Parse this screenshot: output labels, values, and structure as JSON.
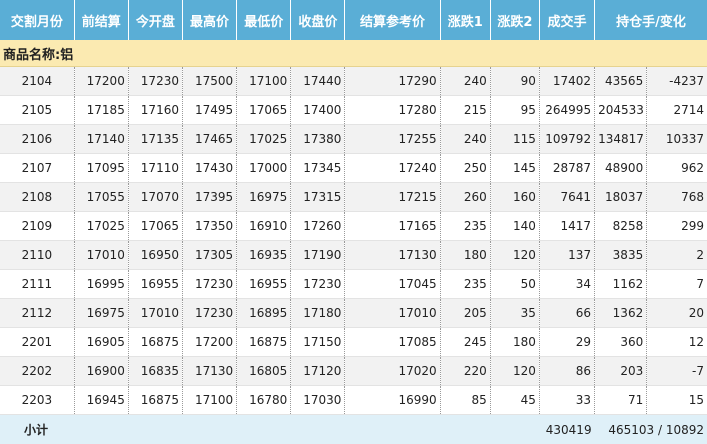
{
  "table": {
    "headers": [
      "交割月份",
      "前结算",
      "今开盘",
      "最高价",
      "最低价",
      "收盘价",
      "结算参考价",
      "涨跌1",
      "涨跌2",
      "成交手",
      "持仓手/变化"
    ],
    "group_label": "商品名称:铝",
    "rows": [
      [
        "2104",
        "17200",
        "17230",
        "17500",
        "17100",
        "17440",
        "17290",
        "240",
        "90",
        "17402",
        "43565",
        "-4237"
      ],
      [
        "2105",
        "17185",
        "17160",
        "17495",
        "17065",
        "17400",
        "17280",
        "215",
        "95",
        "264995",
        "204533",
        "2714"
      ],
      [
        "2106",
        "17140",
        "17135",
        "17465",
        "17025",
        "17380",
        "17255",
        "240",
        "115",
        "109792",
        "134817",
        "10337"
      ],
      [
        "2107",
        "17095",
        "17110",
        "17430",
        "17000",
        "17345",
        "17240",
        "250",
        "145",
        "28787",
        "48900",
        "962"
      ],
      [
        "2108",
        "17055",
        "17070",
        "17395",
        "16975",
        "17315",
        "17215",
        "260",
        "160",
        "7641",
        "18037",
        "768"
      ],
      [
        "2109",
        "17025",
        "17065",
        "17350",
        "16910",
        "17260",
        "17165",
        "235",
        "140",
        "1417",
        "8258",
        "299"
      ],
      [
        "2110",
        "17010",
        "16950",
        "17305",
        "16935",
        "17190",
        "17130",
        "180",
        "120",
        "137",
        "3835",
        "2"
      ],
      [
        "2111",
        "16995",
        "16955",
        "17230",
        "16955",
        "17230",
        "17045",
        "235",
        "50",
        "34",
        "1162",
        "7"
      ],
      [
        "2112",
        "16975",
        "17010",
        "17230",
        "16895",
        "17180",
        "17010",
        "205",
        "35",
        "66",
        "1362",
        "20"
      ],
      [
        "2201",
        "16905",
        "16875",
        "17200",
        "16875",
        "17150",
        "17085",
        "245",
        "180",
        "29",
        "360",
        "12"
      ],
      [
        "2202",
        "16900",
        "16835",
        "17130",
        "16805",
        "17120",
        "17020",
        "220",
        "120",
        "86",
        "203",
        "-7"
      ],
      [
        "2203",
        "16945",
        "16875",
        "17100",
        "16780",
        "17030",
        "16990",
        "85",
        "45",
        "33",
        "71",
        "15"
      ]
    ],
    "footer": {
      "label": "小计",
      "volume": "430419",
      "open_interest": "465103 / 10892"
    }
  }
}
